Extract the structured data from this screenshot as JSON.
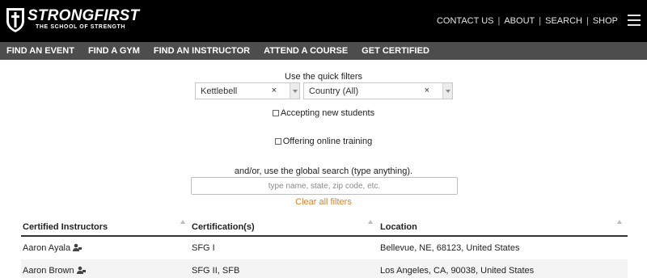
{
  "brand": {
    "name": "STRONGFIRST",
    "tagline": "THE SCHOOL OF STRENGTH"
  },
  "top_links": [
    "CONTACT US",
    "ABOUT",
    "SEARCH",
    "SHOP"
  ],
  "nav": [
    "FIND AN EVENT",
    "FIND A GYM",
    "FIND AN INSTRUCTOR",
    "ATTEND A COURSE",
    "GET CERTIFIED"
  ],
  "filters": {
    "quick_label": "Use the quick filters",
    "certification": {
      "value": "Kettlebell",
      "clear": "×"
    },
    "country": {
      "value": "Country (All)",
      "clear": "×"
    },
    "accepting_label": "Accepting new students",
    "online_label": "Offering online training",
    "global_label": "and/or, use the global search (type anything).",
    "search_placeholder": "type name, state, zip code, etc.",
    "search_value": "",
    "clear_all": "Clear all filters"
  },
  "table": {
    "headers": [
      "Certified Instructors",
      "Certification(s)",
      "Location"
    ],
    "rows": [
      {
        "name": "Aaron Ayala",
        "cert": "SFG I",
        "location": "Bellevue, NE, 68123, United States"
      },
      {
        "name": "Aaron Brown",
        "cert": "SFG II, SFB",
        "location": "Los Angeles, CA, 90038, United States"
      }
    ]
  },
  "colors": {
    "header_bg": "#000000",
    "nav_bg": "#4d4d4d",
    "accent": "#d9822b"
  },
  "icons": {
    "logo": "shield-cross-icon",
    "menu": "hamburger-icon",
    "row_person": "person-teacher-icon"
  }
}
